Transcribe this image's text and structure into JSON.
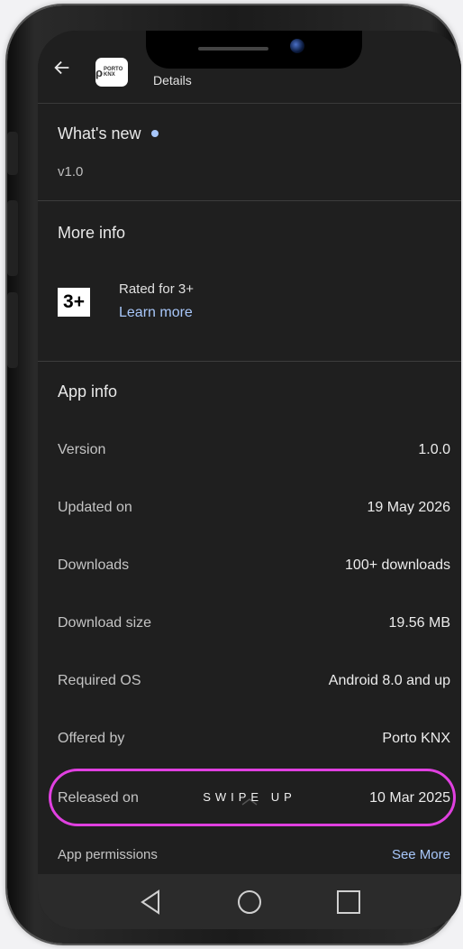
{
  "topbar": {
    "title": "Details",
    "app_logo_text": "PORTO KNX"
  },
  "whats_new": {
    "title": "What's new",
    "version": "v1.0"
  },
  "more_info": {
    "title": "More info",
    "rating_badge": "3+",
    "rating_text": "Rated for 3+",
    "learn_more": "Learn more"
  },
  "app_info": {
    "title": "App info",
    "rows": [
      {
        "label": "Version",
        "value": "1.0.0"
      },
      {
        "label": "Updated on",
        "value": "19 May 2026"
      },
      {
        "label": "Downloads",
        "value": "100+ downloads"
      },
      {
        "label": "Download size",
        "value": "19.56 MB"
      },
      {
        "label": "Required OS",
        "value": "Android 8.0 and up"
      },
      {
        "label": "Offered by",
        "value": "Porto KNX"
      },
      {
        "label": "Released on",
        "value": "10 Mar 2025"
      }
    ],
    "permissions_label": "App permissions",
    "permissions_link": "See More"
  },
  "overlay": {
    "swipe_text": "SWIPE UP",
    "highlight_color": "#e040e0"
  },
  "colors": {
    "background": "#1f1f1f",
    "link": "#a8c7fa",
    "dot": "#a8c7fa"
  }
}
